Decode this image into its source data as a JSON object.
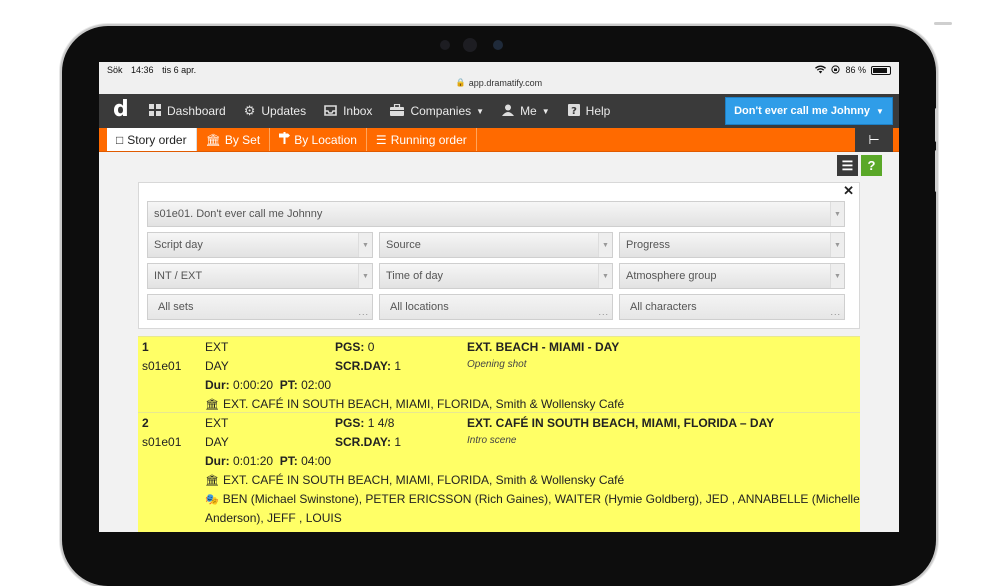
{
  "status_bar": {
    "carrier": "Sök",
    "time": "14:36",
    "date": "tis 6 apr.",
    "battery": "86 %"
  },
  "url": "app.dramatify.com",
  "nav": {
    "logo": "d",
    "items": [
      {
        "label": "Dashboard",
        "icon": "dashboard-icon"
      },
      {
        "label": "Updates",
        "icon": "gear-icon"
      },
      {
        "label": "Inbox",
        "icon": "inbox-icon"
      },
      {
        "label": "Companies",
        "icon": "briefcase-icon"
      },
      {
        "label": "Me",
        "icon": "user-icon"
      },
      {
        "label": "Help",
        "icon": "help-icon"
      }
    ],
    "project": "Don't ever call me Johnny"
  },
  "tabs": [
    {
      "label": "Story order"
    },
    {
      "label": "By Set"
    },
    {
      "label": "By Location"
    },
    {
      "label": "Running order"
    }
  ],
  "filters": {
    "episode": "s01e01. Don't ever call me Johnny",
    "script_day": "Script day",
    "source": "Source",
    "progress": "Progress",
    "int_ext": "INT / EXT",
    "time_of_day": "Time of day",
    "atmosphere": "Atmosphere group",
    "all_sets": "All sets",
    "all_locations": "All locations",
    "all_characters": "All characters"
  },
  "scenes": [
    {
      "number": "1",
      "episode": "s01e01",
      "int_ext": "EXT",
      "time": "DAY",
      "pgs_label": "PGS:",
      "pgs": "0",
      "scrday_label": "SCR.DAY:",
      "scrday": "1",
      "heading": "EXT. BEACH - MIAMI - DAY",
      "description": "Opening shot",
      "dur_label": "Dur:",
      "dur": "0:00:20",
      "pt_label": "PT:",
      "pt": "02:00",
      "set": "EXT. CAFÉ IN SOUTH BEACH, MIAMI, FLORIDA, Smith & Wollensky Café"
    },
    {
      "number": "2",
      "episode": "s01e01",
      "int_ext": "EXT",
      "time": "DAY",
      "pgs_label": "PGS:",
      "pgs": "1 4/8",
      "scrday_label": "SCR.DAY:",
      "scrday": "1",
      "heading": "EXT. CAFÉ IN SOUTH BEACH, MIAMI, FLORIDA – DAY",
      "description": "Intro scene",
      "dur_label": "Dur:",
      "dur": "0:01:20",
      "pt_label": "PT:",
      "pt": "04:00",
      "set": "EXT. CAFÉ IN SOUTH BEACH, MIAMI, FLORIDA, Smith & Wollensky Café",
      "characters_line1": "BEN (Michael Swinstone), PETER ERICSSON (Rich Gaines), WAITER (Hymie Goldberg), JED , ANNABELLE (Michelle",
      "characters_line2": "Anderson), JEFF , LOUIS"
    }
  ]
}
